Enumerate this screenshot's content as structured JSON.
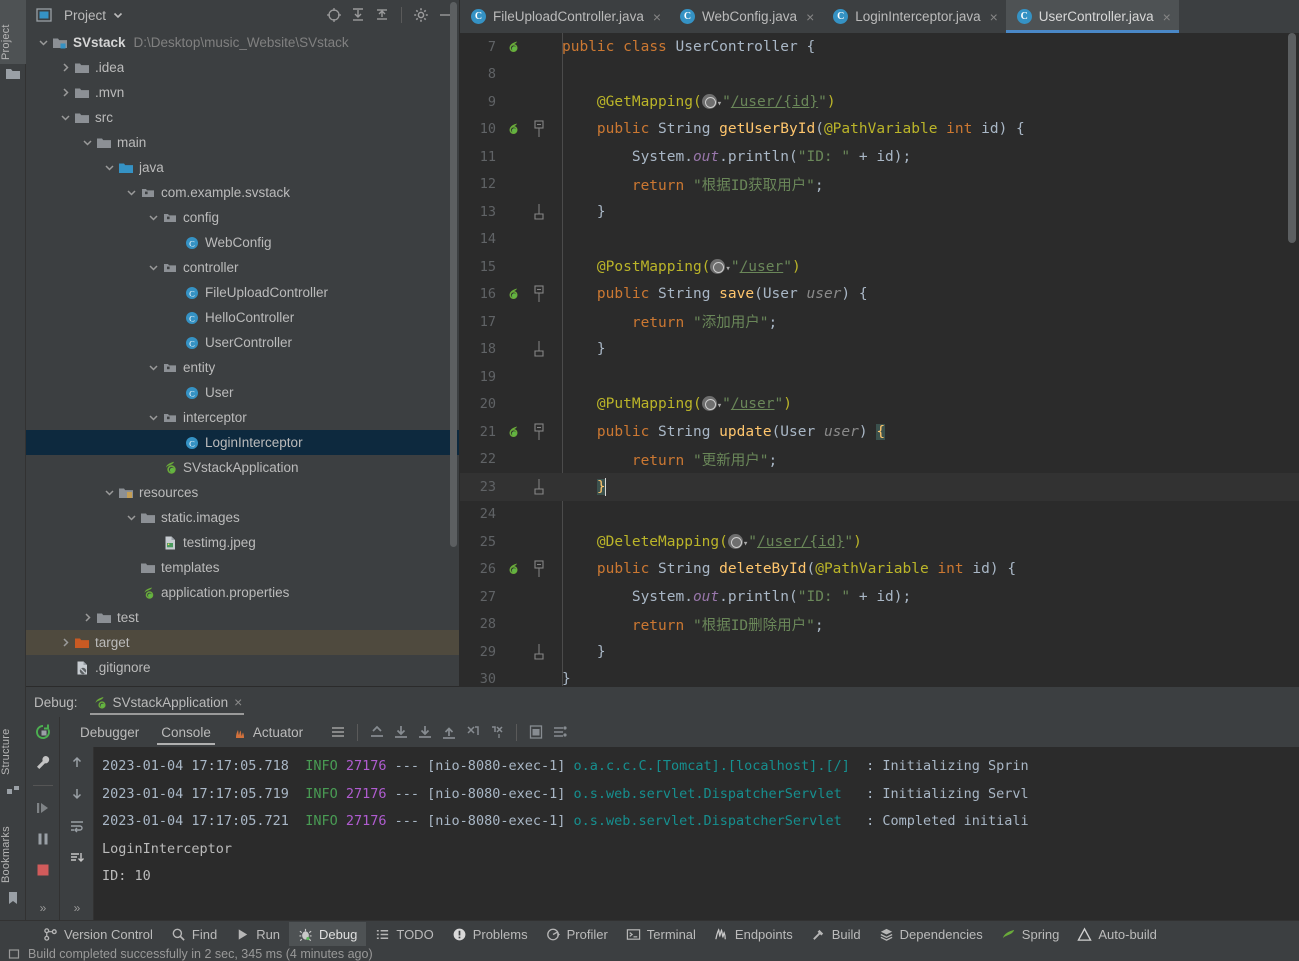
{
  "rail": {
    "project_label": "Project",
    "structure_label": "Structure",
    "bookmarks_label": "Bookmarks"
  },
  "project_panel": {
    "title": "Project",
    "dropdown_icon": "chevron-down-icon",
    "toolbar_icons": [
      "locate-icon",
      "expand-all-icon",
      "collapse-all-icon",
      "settings-gear-icon",
      "minimize-icon"
    ],
    "tree": [
      {
        "depth": 0,
        "chevron": "down",
        "icon": "module-folder",
        "label": "SVstack",
        "bold": true,
        "path": "D:\\Desktop\\music_Website\\SVstack"
      },
      {
        "depth": 1,
        "chevron": "right",
        "icon": "folder",
        "label": ".idea"
      },
      {
        "depth": 1,
        "chevron": "right",
        "icon": "folder",
        "label": ".mvn"
      },
      {
        "depth": 1,
        "chevron": "down",
        "icon": "folder",
        "label": "src"
      },
      {
        "depth": 2,
        "chevron": "down",
        "icon": "folder",
        "label": "main"
      },
      {
        "depth": 3,
        "chevron": "down",
        "icon": "source-folder",
        "label": "java"
      },
      {
        "depth": 4,
        "chevron": "down",
        "icon": "package",
        "label": "com.example.svstack"
      },
      {
        "depth": 5,
        "chevron": "down",
        "icon": "package",
        "label": "config"
      },
      {
        "depth": 6,
        "chevron": "none",
        "icon": "java-class",
        "label": "WebConfig"
      },
      {
        "depth": 5,
        "chevron": "down",
        "icon": "package",
        "label": "controller"
      },
      {
        "depth": 6,
        "chevron": "none",
        "icon": "java-class",
        "label": "FileUploadController"
      },
      {
        "depth": 6,
        "chevron": "none",
        "icon": "java-class",
        "label": "HelloController"
      },
      {
        "depth": 6,
        "chevron": "none",
        "icon": "java-class",
        "label": "UserController"
      },
      {
        "depth": 5,
        "chevron": "down",
        "icon": "package",
        "label": "entity"
      },
      {
        "depth": 6,
        "chevron": "none",
        "icon": "java-class",
        "label": "User"
      },
      {
        "depth": 5,
        "chevron": "down",
        "icon": "package",
        "label": "interceptor"
      },
      {
        "depth": 6,
        "chevron": "none",
        "icon": "java-class",
        "label": "LoginInterceptor",
        "selected": true
      },
      {
        "depth": 5,
        "chevron": "none",
        "icon": "spring-boot",
        "label": "SVstackApplication"
      },
      {
        "depth": 3,
        "chevron": "down",
        "icon": "resource-folder",
        "label": "resources"
      },
      {
        "depth": 4,
        "chevron": "down",
        "icon": "folder",
        "label": "static.images"
      },
      {
        "depth": 5,
        "chevron": "none",
        "icon": "image-file",
        "label": "testimg.jpeg"
      },
      {
        "depth": 4,
        "chevron": "none",
        "icon": "folder",
        "label": "templates"
      },
      {
        "depth": 4,
        "chevron": "none",
        "icon": "spring-props",
        "label": "application.properties"
      },
      {
        "depth": 2,
        "chevron": "right",
        "icon": "folder",
        "label": "test"
      },
      {
        "depth": 1,
        "chevron": "right",
        "icon": "target-folder",
        "label": "target",
        "highlight": true
      },
      {
        "depth": 1,
        "chevron": "none",
        "icon": "gitignore-file",
        "label": ".gitignore"
      }
    ]
  },
  "editor": {
    "tabs": [
      {
        "label": "FileUploadController.java",
        "icon": "java-class-icon",
        "active": false,
        "close": "×"
      },
      {
        "label": "WebConfig.java",
        "icon": "java-class-icon",
        "active": false,
        "close": "×"
      },
      {
        "label": "LoginInterceptor.java",
        "icon": "java-class-icon",
        "active": false,
        "close": "×"
      },
      {
        "label": "UserController.java",
        "icon": "java-class-icon",
        "active": true,
        "close": "×"
      }
    ],
    "first_line_number": 7,
    "lines": [
      {
        "n": 7,
        "mark": "spring-bean-gutter-icon",
        "fold": "",
        "tokens": [
          [
            "kw",
            "public"
          ],
          [
            "pln",
            " "
          ],
          [
            "kw",
            "class"
          ],
          [
            "pln",
            " "
          ],
          [
            "cls",
            "UserController"
          ],
          [
            "pln",
            " {"
          ]
        ]
      },
      {
        "n": 8,
        "mark": "",
        "fold": "",
        "tokens": []
      },
      {
        "n": 9,
        "mark": "",
        "fold": "",
        "indent": 4,
        "tokens": [
          [
            "ann",
            "@GetMapping("
          ],
          [
            "globe",
            ""
          ],
          [
            "str",
            "\""
          ],
          [
            "lnk",
            "/user/{id}"
          ],
          [
            "str",
            "\""
          ],
          [
            "ann",
            ")"
          ]
        ]
      },
      {
        "n": 10,
        "mark": "spring-mapping-gutter-icon",
        "fold": "open",
        "indent": 4,
        "tokens": [
          [
            "kw",
            "public"
          ],
          [
            "pln",
            " "
          ],
          [
            "cls",
            "String"
          ],
          [
            "pln",
            " "
          ],
          [
            "mth",
            "getUserById"
          ],
          [
            "pln",
            "("
          ],
          [
            "ann",
            "@PathVariable"
          ],
          [
            "pln",
            " "
          ],
          [
            "kw",
            "int"
          ],
          [
            "pln",
            " "
          ],
          [
            "prm",
            "id"
          ],
          [
            "pln",
            ") {"
          ]
        ]
      },
      {
        "n": 11,
        "mark": "",
        "fold": "",
        "indent": 8,
        "tokens": [
          [
            "pln",
            "System."
          ],
          [
            "fld",
            "out"
          ],
          [
            "pln",
            ".println("
          ],
          [
            "str",
            "\"ID: \""
          ],
          [
            "pln",
            " + "
          ],
          [
            "prm",
            "id"
          ],
          [
            "pln",
            ");"
          ]
        ]
      },
      {
        "n": 12,
        "mark": "",
        "fold": "",
        "indent": 8,
        "tokens": [
          [
            "kw",
            "return"
          ],
          [
            "pln",
            " "
          ],
          [
            "str",
            "\"根据ID获取用户\""
          ],
          [
            "pln",
            ";"
          ]
        ]
      },
      {
        "n": 13,
        "mark": "",
        "fold": "close",
        "indent": 4,
        "tokens": [
          [
            "pln",
            "}"
          ]
        ]
      },
      {
        "n": 14,
        "mark": "",
        "fold": "",
        "tokens": []
      },
      {
        "n": 15,
        "mark": "",
        "fold": "",
        "indent": 4,
        "tokens": [
          [
            "ann",
            "@PostMapping("
          ],
          [
            "globe",
            ""
          ],
          [
            "str",
            "\""
          ],
          [
            "lnk",
            "/user"
          ],
          [
            "str",
            "\""
          ],
          [
            "ann",
            ")"
          ]
        ]
      },
      {
        "n": 16,
        "mark": "spring-mapping-gutter-icon",
        "fold": "open",
        "indent": 4,
        "tokens": [
          [
            "kw",
            "public"
          ],
          [
            "pln",
            " "
          ],
          [
            "cls",
            "String"
          ],
          [
            "pln",
            " "
          ],
          [
            "mth",
            "save"
          ],
          [
            "pln",
            "("
          ],
          [
            "cls",
            "User"
          ],
          [
            "pln",
            " "
          ],
          [
            "prm-i",
            "user"
          ],
          [
            "pln",
            ") {"
          ]
        ]
      },
      {
        "n": 17,
        "mark": "",
        "fold": "",
        "indent": 8,
        "tokens": [
          [
            "kw",
            "return"
          ],
          [
            "pln",
            " "
          ],
          [
            "str",
            "\"添加用户\""
          ],
          [
            "pln",
            ";"
          ]
        ]
      },
      {
        "n": 18,
        "mark": "",
        "fold": "close",
        "indent": 4,
        "tokens": [
          [
            "pln",
            "}"
          ]
        ]
      },
      {
        "n": 19,
        "mark": "",
        "fold": "",
        "tokens": []
      },
      {
        "n": 20,
        "mark": "",
        "fold": "",
        "indent": 4,
        "tokens": [
          [
            "ann",
            "@PutMapping("
          ],
          [
            "globe",
            ""
          ],
          [
            "str",
            "\""
          ],
          [
            "lnk",
            "/user"
          ],
          [
            "str",
            "\""
          ],
          [
            "ann",
            ")"
          ]
        ]
      },
      {
        "n": 21,
        "mark": "spring-mapping-gutter-icon",
        "fold": "open",
        "indent": 4,
        "tokens": [
          [
            "kw",
            "public"
          ],
          [
            "pln",
            " "
          ],
          [
            "cls",
            "String"
          ],
          [
            "pln",
            " "
          ],
          [
            "mth",
            "update"
          ],
          [
            "pln",
            "("
          ],
          [
            "cls",
            "User"
          ],
          [
            "pln",
            " "
          ],
          [
            "prm-i",
            "user"
          ],
          [
            "pln",
            ") "
          ],
          [
            "brace-hl",
            "{"
          ]
        ]
      },
      {
        "n": 22,
        "mark": "",
        "fold": "",
        "indent": 8,
        "tokens": [
          [
            "kw",
            "return"
          ],
          [
            "pln",
            " "
          ],
          [
            "str",
            "\"更新用户\""
          ],
          [
            "pln",
            ";"
          ]
        ]
      },
      {
        "n": 23,
        "mark": "",
        "fold": "close",
        "indent": 4,
        "current": true,
        "caret": true,
        "tokens": [
          [
            "brace-hl",
            "}"
          ]
        ]
      },
      {
        "n": 24,
        "mark": "",
        "fold": "",
        "tokens": []
      },
      {
        "n": 25,
        "mark": "",
        "fold": "",
        "indent": 4,
        "tokens": [
          [
            "ann",
            "@DeleteMapping("
          ],
          [
            "globe",
            ""
          ],
          [
            "str",
            "\""
          ],
          [
            "lnk",
            "/user/{id}"
          ],
          [
            "str",
            "\""
          ],
          [
            "ann",
            ")"
          ]
        ]
      },
      {
        "n": 26,
        "mark": "spring-mapping-gutter-icon",
        "fold": "open",
        "indent": 4,
        "tokens": [
          [
            "kw",
            "public"
          ],
          [
            "pln",
            " "
          ],
          [
            "cls",
            "String"
          ],
          [
            "pln",
            " "
          ],
          [
            "mth",
            "deleteById"
          ],
          [
            "pln",
            "("
          ],
          [
            "ann",
            "@PathVariable"
          ],
          [
            "pln",
            " "
          ],
          [
            "kw",
            "int"
          ],
          [
            "pln",
            " "
          ],
          [
            "prm",
            "id"
          ],
          [
            "pln",
            ") {"
          ]
        ]
      },
      {
        "n": 27,
        "mark": "",
        "fold": "",
        "indent": 8,
        "tokens": [
          [
            "pln",
            "System."
          ],
          [
            "fld",
            "out"
          ],
          [
            "pln",
            ".println("
          ],
          [
            "str",
            "\"ID: \""
          ],
          [
            "pln",
            " + "
          ],
          [
            "prm",
            "id"
          ],
          [
            "pln",
            ");"
          ]
        ]
      },
      {
        "n": 28,
        "mark": "",
        "fold": "",
        "indent": 8,
        "tokens": [
          [
            "kw",
            "return"
          ],
          [
            "pln",
            " "
          ],
          [
            "str",
            "\"根据ID删除用户\""
          ],
          [
            "pln",
            ";"
          ]
        ]
      },
      {
        "n": 29,
        "mark": "",
        "fold": "close",
        "indent": 4,
        "tokens": [
          [
            "pln",
            "}"
          ]
        ]
      },
      {
        "n": 30,
        "mark": "",
        "fold": "",
        "tokens": [
          [
            "pln",
            "}"
          ]
        ]
      }
    ]
  },
  "debug": {
    "title_label": "Debug:",
    "run_config_name": "SVstackApplication",
    "run_config_icon": "spring-boot-run-icon",
    "close_icon": "×",
    "tabs": [
      {
        "label": "Debugger",
        "active": false,
        "icon": ""
      },
      {
        "label": "Console",
        "active": true,
        "icon": ""
      },
      {
        "label": "Actuator",
        "active": false,
        "icon": "actuator-icon"
      }
    ],
    "toolbar_icons": [
      "layout-settings-icon",
      "step-out-icon",
      "step-over-icon",
      "step-into-icon",
      "force-step-into-icon",
      "run-to-cursor-icon",
      "evaluate-expression-icon",
      "calculator-icon",
      "settings-list-icon"
    ],
    "side_tools": [
      "rerun-icon",
      "wrench-settings-icon",
      "resume-program-icon",
      "pause-program-icon",
      "stop-icon",
      "more-icon"
    ],
    "console_gutter_icons": [
      "scroll-up-icon",
      "scroll-down-icon",
      "soft-wrap-icon",
      "scroll-to-end-icon",
      "more-icon"
    ],
    "console_lines": [
      {
        "ts": "2023-01-04 17:17:05.718",
        "level": "INFO",
        "pid": "27176",
        "sep": "---",
        "thread": "[nio-8080-exec-1]",
        "logger": "o.a.c.c.C.[Tomcat].[localhost].[/]",
        "msg": ": Initializing Sprin"
      },
      {
        "ts": "2023-01-04 17:17:05.719",
        "level": "INFO",
        "pid": "27176",
        "sep": "---",
        "thread": "[nio-8080-exec-1]",
        "logger": "o.s.web.servlet.DispatcherServlet",
        "msg": ": Initializing Servl"
      },
      {
        "ts": "2023-01-04 17:17:05.721",
        "level": "INFO",
        "pid": "27176",
        "sep": "---",
        "thread": "[nio-8080-exec-1]",
        "logger": "o.s.web.servlet.DispatcherServlet",
        "msg": ": Completed initiali"
      }
    ],
    "stdout_lines": [
      "LoginInterceptor",
      "ID: 10"
    ]
  },
  "toolwindow_bar": {
    "items": [
      {
        "label": "Version Control",
        "icon": "branch-icon",
        "active": false
      },
      {
        "label": "Find",
        "icon": "search-icon",
        "active": false
      },
      {
        "label": "Run",
        "icon": "play-icon",
        "active": false
      },
      {
        "label": "Debug",
        "icon": "bug-icon",
        "active": true
      },
      {
        "label": "TODO",
        "icon": "list-icon",
        "active": false
      },
      {
        "label": "Problems",
        "icon": "error-icon",
        "active": false
      },
      {
        "label": "Profiler",
        "icon": "profiler-icon",
        "active": false
      },
      {
        "label": "Terminal",
        "icon": "terminal-icon",
        "active": false
      },
      {
        "label": "Endpoints",
        "icon": "endpoints-icon",
        "active": false
      },
      {
        "label": "Build",
        "icon": "hammer-icon",
        "active": false
      },
      {
        "label": "Dependencies",
        "icon": "layers-icon",
        "active": false
      },
      {
        "label": "Spring",
        "icon": "spring-leaf-icon",
        "active": false
      },
      {
        "label": "Auto-build",
        "icon": "warning-icon",
        "active": false
      }
    ]
  },
  "status_bar": {
    "icon": "build-status-icon",
    "text": "Build completed successfully in 2 sec, 345 ms (4 minutes ago)"
  },
  "colors": {
    "editor_bg": "#2b2b2b",
    "panel_bg": "#3c3f41",
    "accent_blue": "#4a88c7",
    "selection_blue": "#0d293e",
    "target_highlight": "#4f4a3e",
    "class_icon_blue": "#3592c4",
    "keyword_orange": "#cc7832",
    "string_green": "#6a8759",
    "method_yellow": "#ffc66d",
    "annotation_olive": "#bbb529",
    "logger_teal": "#168f8f",
    "pid_purple": "#b05cd0",
    "level_green": "#499c54"
  }
}
